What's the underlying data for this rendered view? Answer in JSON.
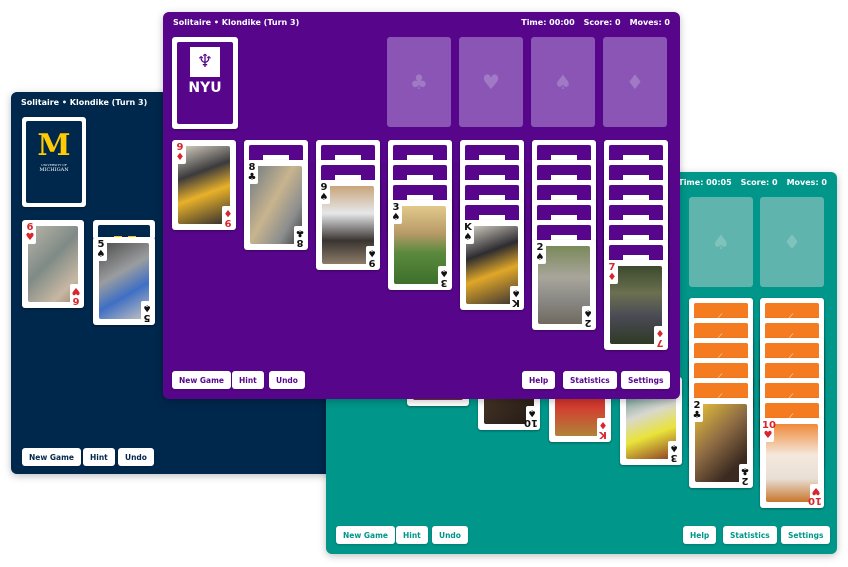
{
  "windows": {
    "michigan": {
      "title": "Solitaire • Klondike (Turn 3)",
      "theme_color": "#00274c",
      "stock_logo": {
        "letter": "M",
        "caption1": "UNIVERSITY OF",
        "caption2": "MICHIGAN",
        "color": "#ffcb05"
      },
      "tableau_visible": [
        {
          "rank": "6",
          "suit": "♥",
          "color": "red"
        },
        {
          "rank": "5",
          "suit": "♠",
          "color": "black"
        }
      ],
      "buttons": [
        "New Game",
        "Hint",
        "Undo"
      ]
    },
    "nyu": {
      "title": "Solitaire • Klondike (Turn 3)",
      "time": "Time: 00:00",
      "score": "Score: 0",
      "moves": "Moves: 0",
      "theme_color": "#57068c",
      "stock_logo": {
        "text": "NYU",
        "icon": "torch-icon"
      },
      "foundations": [
        "♣",
        "♥",
        "♠",
        "♦"
      ],
      "tableau": [
        {
          "hidden": 0,
          "rank": "9",
          "suit": "♦",
          "color": "red"
        },
        {
          "hidden": 1,
          "rank": "8",
          "suit": "♣",
          "color": "black"
        },
        {
          "hidden": 2,
          "rank": "9",
          "suit": "♠",
          "color": "black"
        },
        {
          "hidden": 3,
          "rank": "3",
          "suit": "♠",
          "color": "black"
        },
        {
          "hidden": 4,
          "rank": "K",
          "suit": "♠",
          "color": "black"
        },
        {
          "hidden": 5,
          "rank": "2",
          "suit": "♠",
          "color": "black"
        },
        {
          "hidden": 6,
          "rank": "7",
          "suit": "♦",
          "color": "red"
        }
      ],
      "buttons_left": [
        "New Game",
        "Hint",
        "Undo"
      ],
      "buttons_right": [
        "Help",
        "Statistics",
        "Settings"
      ]
    },
    "teal": {
      "time": "Time: 00:05",
      "score": "Score: 0",
      "moves": "Moves: 0",
      "theme_color": "#00968a",
      "back_color": "#f47b20",
      "foundations": [
        "♠",
        "♦"
      ],
      "tableau_visible": [
        {
          "rank": "10",
          "suit": "♠",
          "color": "black"
        },
        {
          "rank": "K",
          "suit": "♦",
          "color": "red"
        },
        {
          "rank": "3",
          "suit": "♠",
          "color": "black"
        },
        {
          "rank": "2",
          "suit": "♣",
          "color": "black"
        },
        {
          "rank": "10",
          "suit": "♥",
          "color": "red"
        }
      ],
      "buttons_left": [
        "New Game",
        "Hint",
        "Undo"
      ],
      "buttons_right": [
        "Help",
        "Statistics",
        "Settings"
      ]
    }
  }
}
